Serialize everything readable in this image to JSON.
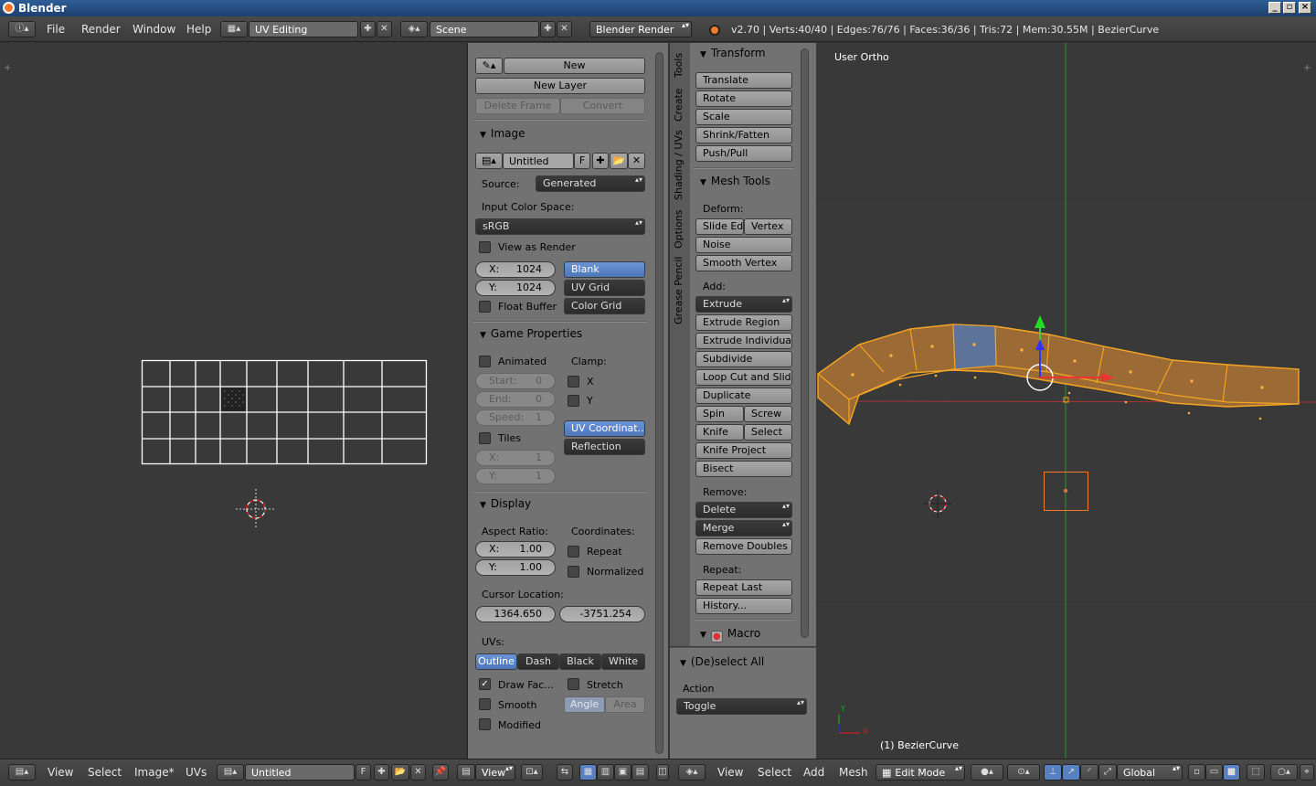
{
  "window": {
    "title": "Blender"
  },
  "topbar": {
    "menus": [
      "File",
      "Render",
      "Window",
      "Help"
    ],
    "screen_layout": "UV Editing",
    "scene": "Scene",
    "engine": "Blender Render",
    "stats": "v2.70 | Verts:40/40 | Edges:76/76 | Faces:36/36 | Tris:72 | Mem:30.55M | BezierCurve"
  },
  "grease_pencil": {
    "new": "New",
    "new_layer": "New Layer",
    "delete_frame": "Delete Frame",
    "convert": "Convert"
  },
  "image": {
    "header": "Image",
    "name": "Untitled",
    "fake_user": "F",
    "source_label": "Source:",
    "source_value": "Generated",
    "color_space_label": "Input Color Space:",
    "color_space_value": "sRGB",
    "view_as_render": "View as Render",
    "x_label": "X:",
    "x_value": "1024",
    "y_label": "Y:",
    "y_value": "1024",
    "float_buffer": "Float Buffer",
    "gen_types": [
      "Blank",
      "UV Grid",
      "Color Grid"
    ],
    "gen_selected": "Blank"
  },
  "game_properties": {
    "header": "Game Properties",
    "animated": "Animated",
    "clamp_label": "Clamp:",
    "clamp_x": "X",
    "clamp_y": "Y",
    "start_label": "Start:",
    "start_value": "0",
    "end_label": "End:",
    "end_value": "0",
    "speed_label": "Speed:",
    "speed_value": "1",
    "tiles": "Tiles",
    "tx_label": "X:",
    "tx_value": "1",
    "ty_label": "Y:",
    "ty_value": "1",
    "mapping": [
      "UV Coordinat...",
      "Reflection"
    ]
  },
  "display": {
    "header": "Display",
    "aspect_label": "Aspect Ratio:",
    "coordinates_label": "Coordinates:",
    "ax_label": "X:",
    "ax_value": "1.00",
    "ay_label": "Y:",
    "ay_value": "1.00",
    "repeat": "Repeat",
    "normalized": "Normalized",
    "cursor_label": "Cursor Location:",
    "cursor_x": "1364.650",
    "cursor_y": "-3751.254",
    "uvs_label": "UVs:",
    "uv_styles": [
      "Outline",
      "Dash",
      "Black",
      "White"
    ],
    "draw_faces": "Draw Fac...",
    "stretch": "Stretch",
    "smooth": "Smooth",
    "angle": "Angle",
    "area": "Area",
    "modified": "Modified"
  },
  "vtabs": [
    "Tools",
    "Create",
    "Shading / UVs",
    "Options",
    "Grease Pencil"
  ],
  "tools": {
    "transform_header": "Transform",
    "transform": [
      "Translate",
      "Rotate",
      "Scale",
      "Shrink/Fatten",
      "Push/Pull"
    ],
    "mesh_tools_header": "Mesh Tools",
    "deform_label": "Deform:",
    "slide_edge": "Slide Ed",
    "vertex": "Vertex",
    "noise": "Noise",
    "smooth_vertex": "Smooth Vertex",
    "add_label": "Add:",
    "extrude": "Extrude",
    "add_items": [
      "Extrude Region",
      "Extrude Individual",
      "Subdivide",
      "Loop Cut and Slide",
      "Duplicate"
    ],
    "spin": "Spin",
    "screw": "Screw",
    "knife": "Knife",
    "select": "Select",
    "knife_project": "Knife Project",
    "bisect": "Bisect",
    "remove_label": "Remove:",
    "delete": "Delete",
    "merge": "Merge",
    "remove_doubles": "Remove Doubles",
    "repeat_label": "Repeat:",
    "repeat_last": "Repeat Last",
    "history": "History...",
    "macro": "Macro"
  },
  "operator": {
    "header": "(De)select All",
    "action_label": "Action",
    "action_value": "Toggle"
  },
  "viewport": {
    "view_name": "User Ortho",
    "object_label": "(1) BezierCurve"
  },
  "bottom_left": {
    "menus": [
      "View",
      "Select",
      "Image*",
      "UVs"
    ],
    "image_name": "Untitled",
    "fake_user": "F",
    "view": "View"
  },
  "bottom_right": {
    "menus": [
      "View",
      "Select",
      "Add",
      "Mesh"
    ],
    "mode": "Edit Mode",
    "orientation": "Global"
  },
  "colors": {
    "accent": "#5680c2",
    "orange": "#f5a623",
    "bg": "#393939",
    "panel": "#727272"
  }
}
